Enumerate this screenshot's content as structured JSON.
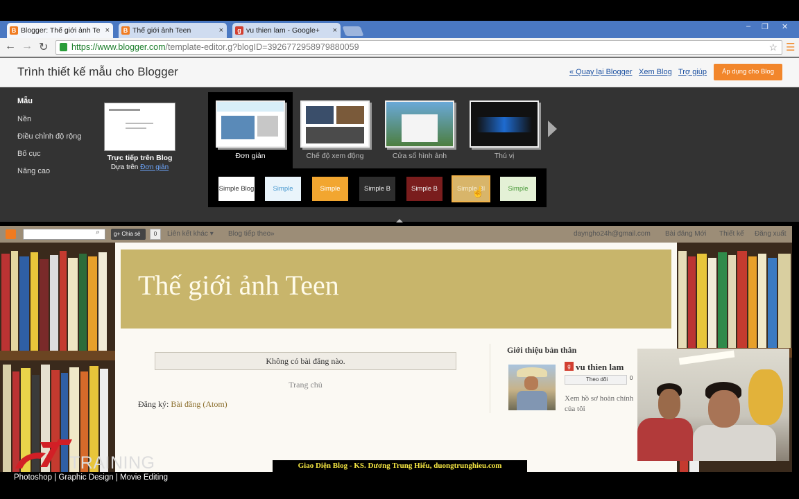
{
  "browser": {
    "tabs": [
      {
        "title": "Blogger: Thế giới ảnh Te",
        "favicon": "blogger-icon",
        "active": true
      },
      {
        "title": "Thế giới ảnh Teen",
        "favicon": "blogger-icon",
        "active": false
      },
      {
        "title": "vu thien lam - Google+",
        "favicon": "gplus-icon",
        "active": false
      }
    ],
    "tab_close": "×",
    "url_host": "https://www.blogger.com",
    "url_path": "/template-editor.g?blogID=3926772958979880059",
    "window_controls": [
      "–",
      "❐",
      "✕"
    ]
  },
  "designer": {
    "title": "Trình thiết kế mẫu cho Blogger",
    "links": [
      "« Quay lại Blogger",
      "Xem Blog",
      "Trợ giúp"
    ],
    "apply_button": "Áp dụng cho Blog",
    "sidebar": [
      "Mẫu",
      "Nền",
      "Điều chỉnh độ rộng",
      "Bố cục",
      "Nâng cao"
    ],
    "live_label": "Trực tiếp trên Blog",
    "based_on_prefix": "Dựa trên ",
    "based_on_link": "Đơn giản",
    "templates": [
      "Đơn giản",
      "Chế độ xem động",
      "Cửa sổ hình ảnh",
      "Thú vị"
    ],
    "variants": [
      "Simple Blog",
      "Simple",
      "Simple",
      "Simple B",
      "Simple B",
      "Simple Bl",
      "Simple"
    ]
  },
  "blog": {
    "navbar": {
      "share": "Chia sẻ",
      "share_count": "0",
      "links_left": [
        "Liên kết khác ▾",
        "Blog tiếp theo»"
      ],
      "links_right": [
        "dayngho24h@gmail.com",
        "Bài đăng Mới",
        "Thiết kế",
        "Đăng xuất"
      ]
    },
    "title": "Thế giới ảnh Teen",
    "no_posts": "Không có bài đăng nào.",
    "home_link": "Trang chủ",
    "subscribe_prefix": "Đăng ký: ",
    "subscribe_link": "Bài đăng (Atom)",
    "about_title": "Giới thiệu bản thân",
    "profile_name": "vu thien lam",
    "follow": "Theo dõi",
    "follow_count": "0",
    "profile_desc": "Xem hồ sơ hoàn chỉnh của tôi"
  },
  "overlay": {
    "caption": "Giao Diện Blog - KS. Dương Trung Hiếu, duongtrunghieu.com",
    "logo_text": "TRAINING",
    "tagline": "Photoshop | Graphic Design | Movie Editing"
  },
  "colors": {
    "accent_orange": "#f2862b",
    "tabbar_blue": "#4a78c2",
    "blog_header": "#c8b56b",
    "link_blue": "#1a4fa0"
  }
}
